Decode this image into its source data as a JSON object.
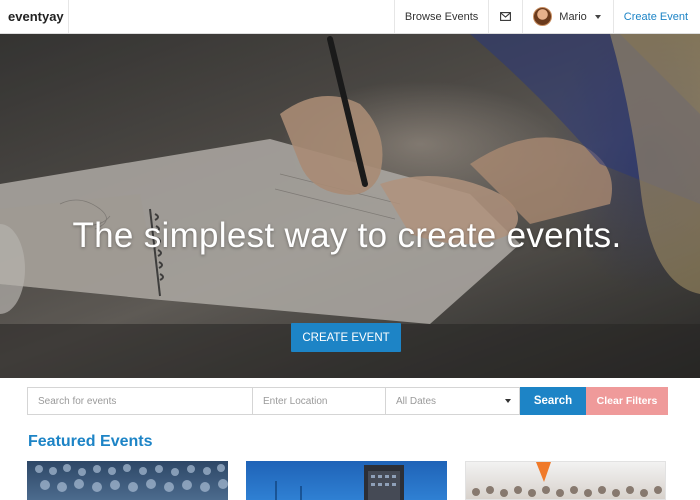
{
  "nav": {
    "brand": "eventyay",
    "browse_events": "Browse Events",
    "mail_icon": "envelope-icon",
    "user_name": "Mario",
    "create_event": "Create Event"
  },
  "hero": {
    "title": "The simplest way to create events.",
    "cta": "CREATE EVENT"
  },
  "search": {
    "events_placeholder": "Search for events",
    "location_placeholder": "Enter Location",
    "dates_selected": "All Dates",
    "search_label": "Search",
    "clear_label": "Clear Filters"
  },
  "featured": {
    "title": "Featured Events"
  },
  "colors": {
    "accent": "#1d84c6",
    "clear_button": "#ef9a9a"
  }
}
